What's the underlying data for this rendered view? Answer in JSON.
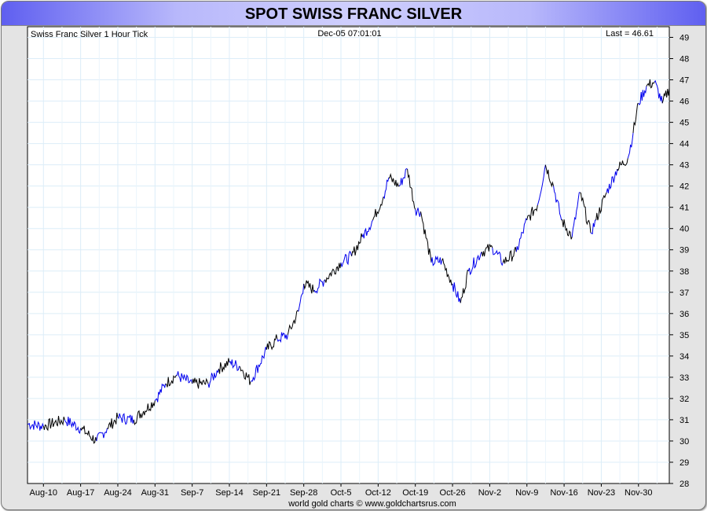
{
  "header": {
    "title": "SPOT SWISS FRANC SILVER"
  },
  "chart_data": {
    "type": "line",
    "title": "Swiss Franc Silver 1 Hour Tick",
    "timestamp": "Dec-05  07:01:01",
    "last_label": "Last = 46.61",
    "last": 46.61,
    "footer": "world gold charts © www.goldchartsrus.com",
    "xlabel": "",
    "ylabel": "",
    "x_unit": "days since Aug-7",
    "xlim": [
      0,
      120.8
    ],
    "ylim": [
      28,
      49.5
    ],
    "y_ticks": [
      28,
      29,
      30,
      31,
      32,
      33,
      34,
      35,
      36,
      37,
      38,
      39,
      40,
      41,
      42,
      43,
      44,
      45,
      46,
      47,
      48,
      49
    ],
    "x_ticks": [
      {
        "x": 3,
        "label": "Aug-10"
      },
      {
        "x": 10,
        "label": "Aug-17"
      },
      {
        "x": 17,
        "label": "Aug-24"
      },
      {
        "x": 24,
        "label": "Aug-31"
      },
      {
        "x": 31,
        "label": "Sep-7"
      },
      {
        "x": 38,
        "label": "Sep-14"
      },
      {
        "x": 45,
        "label": "Sep-21"
      },
      {
        "x": 52,
        "label": "Sep-28"
      },
      {
        "x": 59,
        "label": "Oct-5"
      },
      {
        "x": 66,
        "label": "Oct-12"
      },
      {
        "x": 73,
        "label": "Oct-19"
      },
      {
        "x": 80,
        "label": "Oct-26"
      },
      {
        "x": 87,
        "label": "Nov-2"
      },
      {
        "x": 94,
        "label": "Nov-9"
      },
      {
        "x": 101,
        "label": "Nov-16"
      },
      {
        "x": 108,
        "label": "Nov-23"
      },
      {
        "x": 115,
        "label": "Nov-30"
      }
    ],
    "grid": true,
    "series": [
      {
        "name": "Swiss Franc Silver",
        "x": [
          0,
          3,
          7,
          10,
          13,
          15,
          17,
          20,
          24,
          26,
          28,
          31,
          34,
          36,
          38,
          40,
          42,
          45,
          47,
          49,
          51,
          52,
          54,
          56,
          59,
          61,
          63,
          65,
          67,
          68,
          70,
          71.5,
          73,
          74,
          76,
          78,
          80,
          81.5,
          83,
          85.5,
          87.5,
          89.5,
          92,
          94,
          96,
          97.5,
          99,
          100.5,
          102.5,
          104,
          106,
          107,
          109,
          111,
          113,
          114,
          115,
          116.5,
          118,
          119.5,
          120.8
        ],
        "y": [
          30.8,
          30.7,
          31.0,
          30.6,
          30.0,
          30.6,
          31.1,
          31.0,
          31.9,
          32.7,
          33.1,
          32.7,
          32.7,
          33.4,
          33.7,
          33.5,
          32.8,
          34.3,
          34.8,
          35.0,
          36.1,
          37.4,
          37.1,
          37.6,
          38.4,
          38.7,
          39.6,
          40.4,
          41.5,
          42.4,
          42.0,
          42.8,
          40.9,
          40.8,
          38.4,
          38.5,
          37.4,
          36.5,
          38.0,
          38.9,
          39.1,
          38.4,
          38.9,
          40.4,
          41.1,
          43.0,
          42.0,
          40.4,
          39.6,
          41.7,
          39.8,
          40.4,
          41.7,
          42.8,
          43.3,
          44.5,
          45.9,
          46.7,
          46.9,
          45.9,
          46.61
        ]
      }
    ]
  }
}
